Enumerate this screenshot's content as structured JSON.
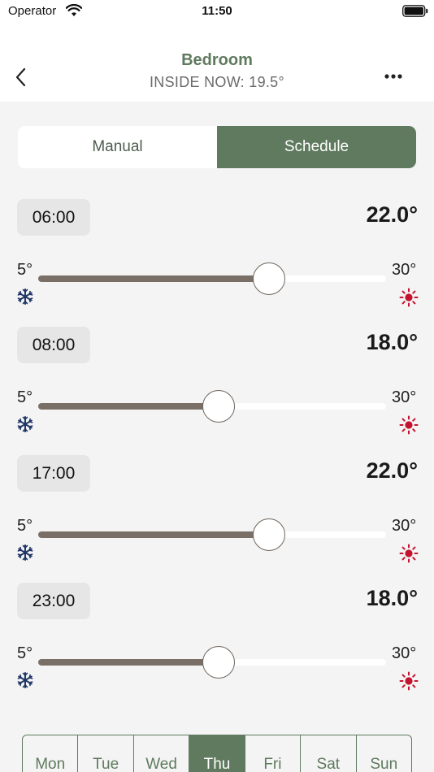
{
  "status_bar": {
    "carrier": "Operator",
    "time": "11:50"
  },
  "header": {
    "title": "Bedroom",
    "subtitle": "INSIDE NOW: 19.5°"
  },
  "mode_tabs": {
    "manual": "Manual",
    "schedule": "Schedule",
    "selected": "Schedule"
  },
  "slider_range": {
    "min": 5,
    "max": 30,
    "min_label": "5°",
    "max_label": "30°"
  },
  "schedule": [
    {
      "time": "06:00",
      "setpoint_label": "22.0°",
      "value": 22.0
    },
    {
      "time": "08:00",
      "setpoint_label": "18.0°",
      "value": 18.0
    },
    {
      "time": "17:00",
      "setpoint_label": "22.0°",
      "value": 22.0
    },
    {
      "time": "23:00",
      "setpoint_label": "18.0°",
      "value": 18.0
    }
  ],
  "days": [
    "Mon",
    "Tue",
    "Wed",
    "Thu",
    "Fri",
    "Sat",
    "Sun"
  ],
  "selected_day": "Thu",
  "colors": {
    "accent": "#5f7a5e",
    "slider_fill": "#7a6f66",
    "cold_icon": "#1f3566",
    "hot_icon": "#c4122f"
  },
  "icons": {
    "back": "chevron-left-icon",
    "more": "ellipsis-icon",
    "cold": "snowflake-icon",
    "hot": "sun-icon"
  }
}
